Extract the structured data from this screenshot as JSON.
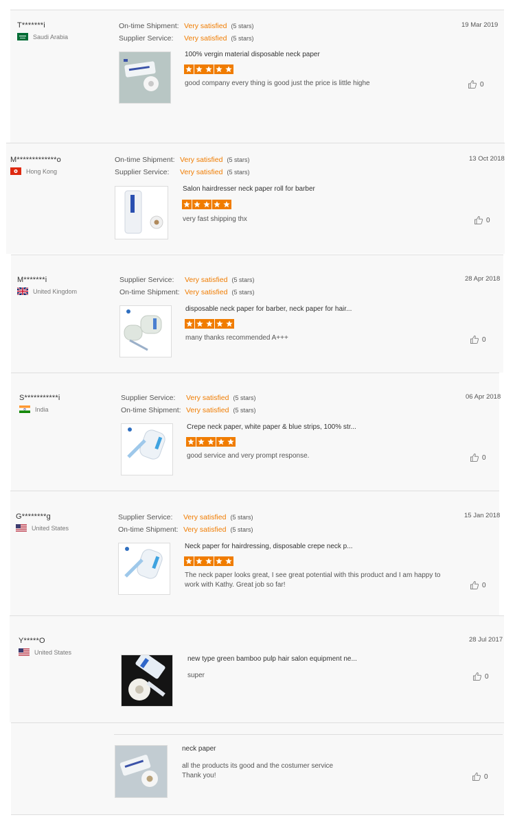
{
  "reviews": [
    {
      "name": "T*******i",
      "country": "Saudi Arabia",
      "flag": "sa",
      "date": "19 Mar 2019",
      "ratings": [
        {
          "label": "On-time Shipment:",
          "value": "Very satisfied",
          "count": "(5 stars)"
        },
        {
          "label": "Supplier Service:",
          "value": "Very satisfied",
          "count": "(5 stars)"
        }
      ],
      "product": "100% vergin material disposable neck paper",
      "stars": 5,
      "comment": "good company every thing is good just the price is little highe",
      "likes": "0"
    },
    {
      "name": "M*************o",
      "country": "Hong Kong",
      "flag": "hk",
      "date": "13 Oct 2018",
      "ratings": [
        {
          "label": "On-time Shipment:",
          "value": "Very satisfied",
          "count": "(5 stars)"
        },
        {
          "label": "Supplier Service:",
          "value": "Very satisfied",
          "count": "(5 stars)"
        }
      ],
      "product": "Salon hairdresser neck paper roll for barber",
      "stars": 5,
      "comment": "very fast shipping thx",
      "likes": "0"
    },
    {
      "name": "M*******i",
      "country": "United Kingdom",
      "flag": "uk",
      "date": "28 Apr 2018",
      "ratings": [
        {
          "label": "Supplier Service:",
          "value": "Very satisfied",
          "count": "(5 stars)"
        },
        {
          "label": "On-time Shipment:",
          "value": "Very satisfied",
          "count": "(5 stars)"
        }
      ],
      "product": "disposable neck paper for barber, neck paper for hair...",
      "stars": 5,
      "comment": "many thanks recommended A+++",
      "likes": "0"
    },
    {
      "name": "S***********i",
      "country": "India",
      "flag": "in",
      "date": "06 Apr 2018",
      "ratings": [
        {
          "label": "Supplier Service:",
          "value": "Very satisfied",
          "count": "(5 stars)"
        },
        {
          "label": "On-time Shipment:",
          "value": "Very satisfied",
          "count": "(5 stars)"
        }
      ],
      "product": "Crepe neck paper, white paper & blue strips, 100% str...",
      "stars": 5,
      "comment": "good service and very prompt response.",
      "likes": "0"
    },
    {
      "name": "G********g",
      "country": "United States",
      "flag": "us",
      "date": "15 Jan 2018",
      "ratings": [
        {
          "label": "Supplier Service:",
          "value": "Very satisfied",
          "count": "(5 stars)"
        },
        {
          "label": "On-time Shipment:",
          "value": "Very satisfied",
          "count": "(5 stars)"
        }
      ],
      "product": "Neck paper for hairdressing, disposable crepe neck p...",
      "stars": 5,
      "comment": "The neck paper looks great, I see great potential with this product and I am happy to work with Kathy. Great job so far!",
      "likes": "0"
    },
    {
      "name": "Y*****O",
      "country": "United States",
      "flag": "us",
      "date": "28 Jul 2017",
      "ratings": [],
      "product": "new type green bamboo pulp hair salon equipment ne...",
      "stars": 0,
      "comment": "super",
      "likes": "0"
    },
    {
      "name": "",
      "country": "",
      "flag": "",
      "date": "",
      "ratings": [],
      "product": "neck paper",
      "stars": 0,
      "comment": "all the products its good and the costumer service Thank you!",
      "likes": "0"
    }
  ],
  "colors": {
    "accent": "#f07c00",
    "star": "#f07c00",
    "background": "#f8f8f8"
  }
}
